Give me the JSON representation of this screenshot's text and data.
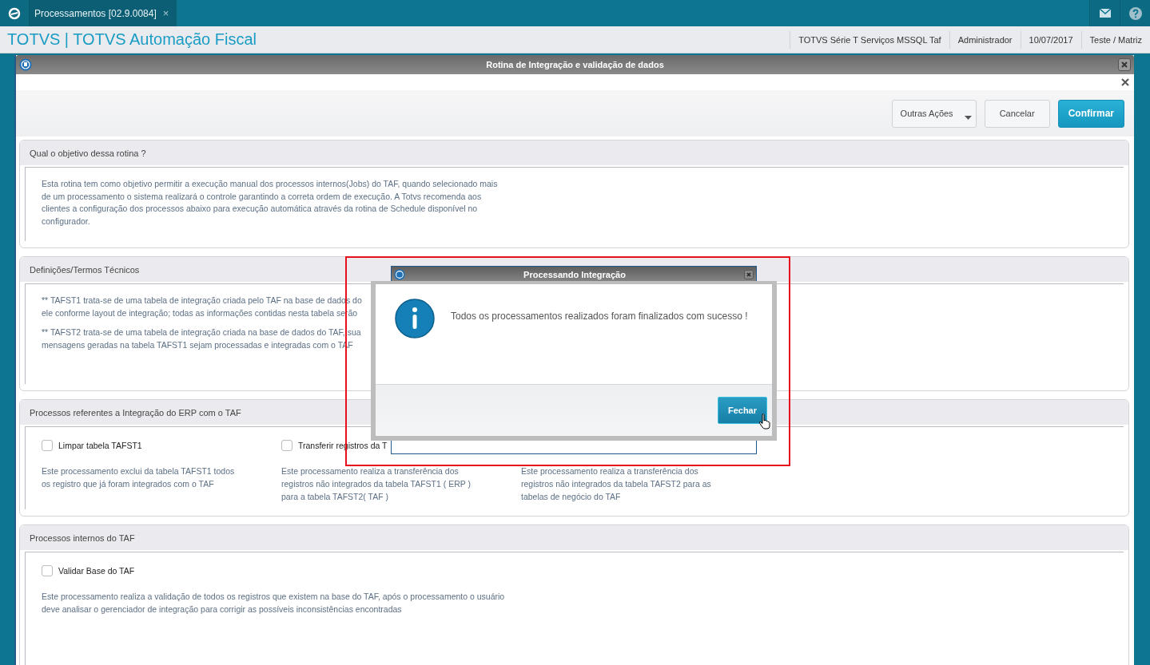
{
  "app_bar": {
    "tab": {
      "label": "Processamentos [02.9.0084]",
      "close": "×",
      "selected": true
    }
  },
  "header": {
    "title": "TOTVS | TOTVS Automação Fiscal",
    "info": [
      "TOTVS Série T Serviços MSSQL Taf",
      "Administrador",
      "10/07/2017",
      "Teste / Matriz"
    ]
  },
  "window": {
    "title": "Rotina de Integração e validação de dados"
  },
  "toolbar": {
    "buttons": [
      {
        "label": "Outras Ações",
        "kind": "menu"
      },
      {
        "label": "Cancelar",
        "kind": "default"
      },
      {
        "label": "Confirmar",
        "kind": "primary"
      }
    ]
  },
  "sections": [
    {
      "title": "Qual o objetivo dessa rotina ?",
      "kind": "text",
      "paragraphs": [
        {
          "lines": [
            "Esta rotina tem como objetivo permitir a execução manual dos processos internos(Jobs) do TAF, quando selecionado mais",
            "de um processamento o sistema realizará o controle garantindo a correta ordem de execução. A Totvs recomenda aos",
            "clientes a configuração dos processos abaixo para execução automática através da rotina de Schedule disponível no",
            "configurador."
          ]
        }
      ]
    },
    {
      "title": "Definições/Termos Técnicos",
      "kind": "text",
      "paragraphs": [
        {
          "lines": [
            "** TAFST1 trata-se de uma tabela de integração criada pelo TAF na base de dados do",
            "ele conforme layout de integração; todas as informações contidas nesta tabela serão"
          ]
        },
        {
          "lines": [
            "** TAFST2 trata-se de uma tabela de integração criada na base de dados do TAF, sua",
            "mensagens geradas na tabela TAFST1 sejam processadas e integradas com o TAF"
          ]
        }
      ]
    },
    {
      "title": "Processos referentes a Integração do ERP com o TAF",
      "kind": "processes",
      "processes": [
        {
          "label": "Limpar tabela TAFST1",
          "checked": false,
          "description": "Este processamento exclui da tabela TAFST1 todos os registro que já foram integrados com o TAF"
        },
        {
          "label": "Transferir registros da T",
          "checked": false,
          "description": "Este processamento realiza a transferência dos registros não integrados da tabela TAFST1 ( ERP ) para a tabela TAFST2( TAF )"
        },
        {
          "description": "Este processamento realiza a transferência dos registros não integrados da tabela TAFST2 para as tabelas de negócio do TAF"
        }
      ]
    },
    {
      "title": "Processos internos do TAF",
      "kind": "processes",
      "processes": [
        {
          "label": "Validar Base do TAF",
          "checked": false,
          "description": "Este processamento realiza a validação de todos os registros que existem na base do TAF, após o processamento o usuário deve analisar o gerenciador de integração para corrigir as possíveis inconsistências encontradas"
        }
      ]
    }
  ],
  "progress_window": {
    "title": "Processando Integração"
  },
  "message_dialog": {
    "message": "Todos os processamentos realizados foram finalizados com sucesso !",
    "button": "Fechar"
  }
}
